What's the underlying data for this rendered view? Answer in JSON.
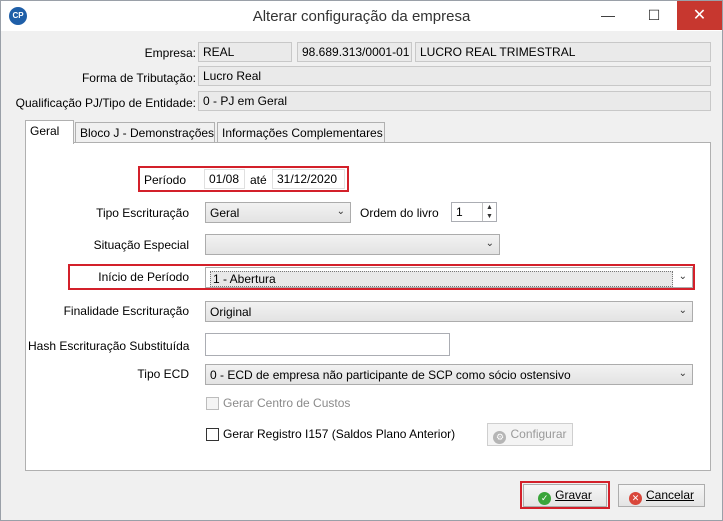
{
  "window": {
    "title": "Alterar configuração da empresa",
    "app_icon": "CP"
  },
  "header": {
    "empresa_label": "Empresa:",
    "empresa_name": "REAL",
    "cnpj": "98.689.313/0001-01",
    "regime": "LUCRO REAL TRIMESTRAL",
    "tributacao_label": "Forma de Tributação:",
    "tributacao_value": "Lucro Real",
    "qualificacao_label": "Qualificação PJ/Tipo de Entidade:",
    "qualificacao_value": "0 - PJ em Geral"
  },
  "tabs": [
    {
      "label": "Geral"
    },
    {
      "label": "Bloco J - Demonstrações"
    },
    {
      "label": "Informações Complementares"
    }
  ],
  "form": {
    "periodo_label": "Período",
    "periodo_start": "01/08",
    "ate_label": "até",
    "periodo_end": "31/12/2020",
    "tipo_escrituracao_label": "Tipo Escrituração",
    "tipo_escrituracao_value": "Geral",
    "ordem_livro_label": "Ordem do livro",
    "ordem_livro_value": "1",
    "situacao_especial_label": "Situação Especial",
    "situacao_especial_value": "",
    "inicio_periodo_label": "Início de Período",
    "inicio_periodo_value": "1 - Abertura",
    "finalidade_label": "Finalidade Escrituração",
    "finalidade_value": "Original",
    "hash_label": "Hash Escrituração Substituída",
    "hash_value": "",
    "tipo_ecd_label": "Tipo ECD",
    "tipo_ecd_value": "0 - ECD de empresa não participante de SCP como sócio ostensivo",
    "gerar_centro_label": "Gerar Centro de Custos",
    "gerar_registro_label": "Gerar Registro I157 (Saldos Plano Anterior)",
    "configurar_label": "Configurar"
  },
  "footer": {
    "gravar_label": "Gravar",
    "cancelar_label": "Cancelar"
  },
  "colors": {
    "highlight": "#d3202a",
    "close_button": "#c7372f",
    "ok_icon": "#3aa53a",
    "cancel_icon": "#d9473b"
  }
}
